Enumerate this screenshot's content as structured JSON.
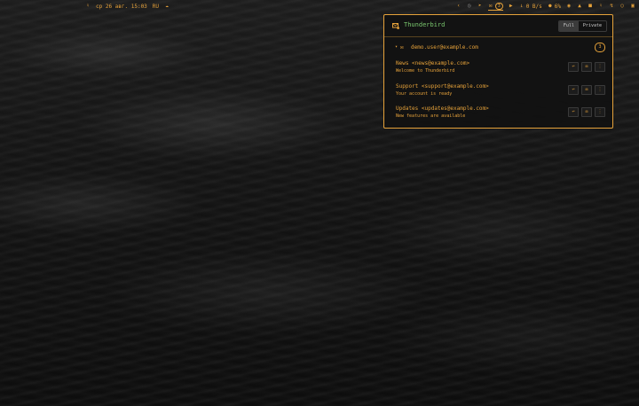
{
  "topbar": {
    "datetime": "ср 26 авг. 15:03",
    "layout": "RU",
    "mail_count": "3",
    "net_speed": "0 B/s",
    "battery": "6%",
    "icons_left": [
      "bell-icon",
      "cloud-icon"
    ],
    "icons_right": [
      "chevron-left-icon",
      "clock-icon",
      "telegram-icon",
      "mail-icon",
      "youtube-icon",
      "download-icon",
      "gamepad-icon",
      "volume-icon",
      "discord-icon",
      "thumbs-icon",
      "lock-icon",
      "bolt-icon",
      "headphones-icon",
      "window-icon"
    ]
  },
  "popup": {
    "title": "Thunderbird",
    "toggle": {
      "full": "Full",
      "private": "Private",
      "active": "Full"
    },
    "account": {
      "email": "demo.user@example.com",
      "count": "3"
    },
    "messages": [
      {
        "from": "News <news@example.com>",
        "subject": "Welcome to Thunderbird"
      },
      {
        "from": "Support <support@example.com>",
        "subject": "Your account is ready"
      },
      {
        "from": "Updates <updates@example.com>",
        "subject": "New features are available"
      }
    ]
  },
  "colors": {
    "accent": "#e6a23a",
    "title_green": "#7bc96f",
    "panel_bg": "#121212"
  }
}
